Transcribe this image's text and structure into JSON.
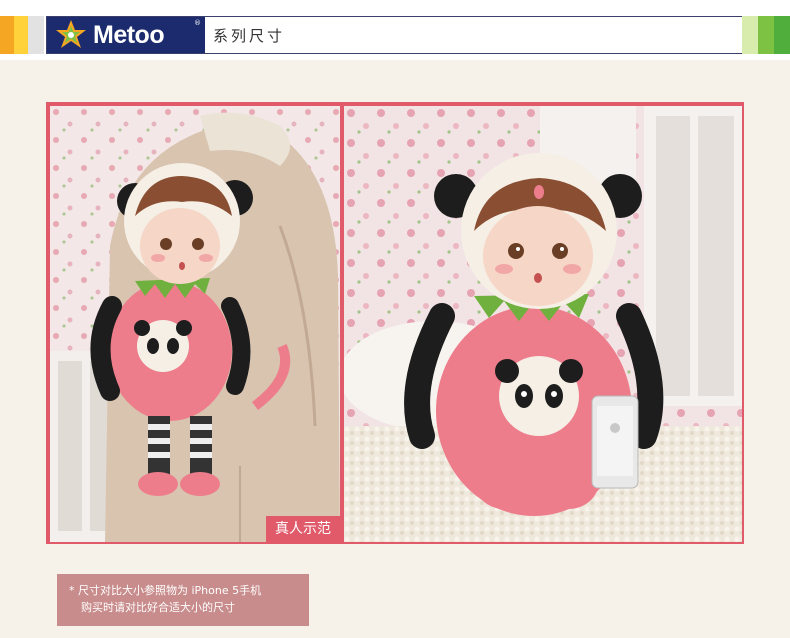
{
  "header": {
    "logo_text": "Metoo",
    "logo_reg": "®",
    "title": "系列尺寸",
    "stripe_colors_left": [
      "#f5a623",
      "#ffd23c",
      "#d8d8d8"
    ],
    "stripe_colors_right": [
      "#a5cf3a",
      "#7dc243",
      "#4fae3c"
    ]
  },
  "photos": {
    "left_caption": "真人示范"
  },
  "note": {
    "line1": "* 尺寸对比大小参照物为 iPhone 5手机",
    "line2": "购买时请对比好合适大小的尺寸"
  },
  "colors": {
    "frame": "#e05a6a",
    "brand_navy": "#1c2a6e",
    "note_bg": "#c98c8c",
    "doll_pink": "#ee7d8c"
  }
}
